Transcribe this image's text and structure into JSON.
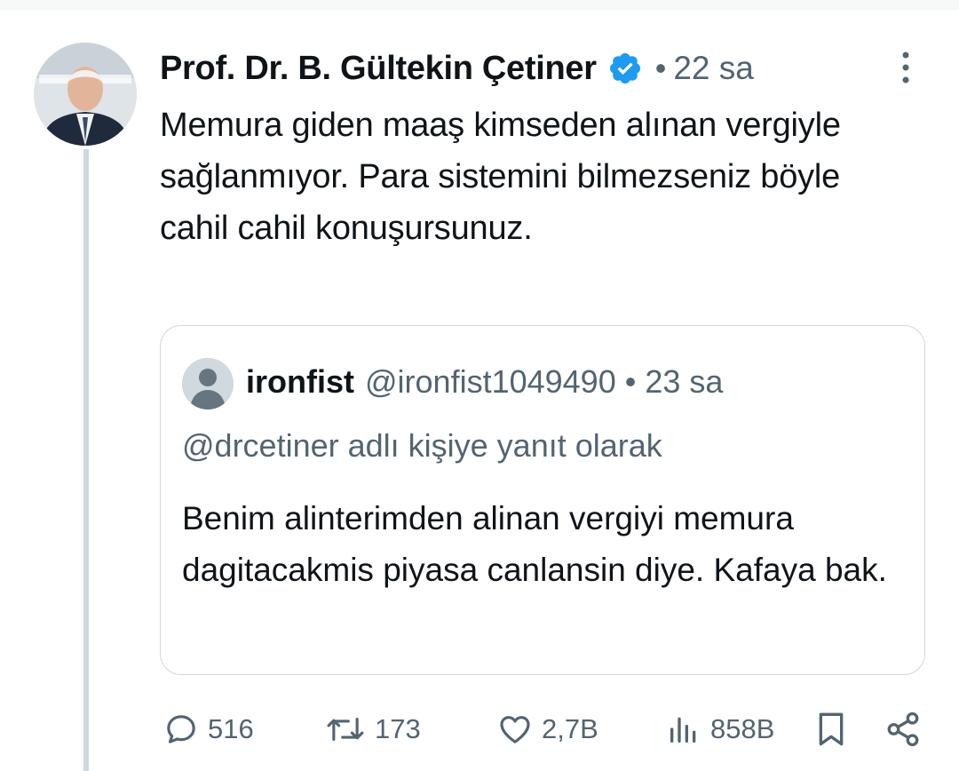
{
  "tweet": {
    "author_name": "Prof. Dr. B. Gültekin Çetiner",
    "time_separator": "•",
    "time": "22 sa",
    "text": "Memura giden maaş kimseden alınan vergiyle sağlanmıyor. Para sistemini bilmezseniz böyle cahil cahil konuşursunuz.",
    "verified_color": "#1d9bf0"
  },
  "quote": {
    "name": "ironfist",
    "handle": "@ironfist1049490",
    "time_separator": "•",
    "time": "23 sa",
    "reply_context": "@drcetiner adlı kişiye yanıt olarak",
    "text": "Benim alinterimden alinan vergiyi memura dagitacakmis piyasa canlansin diye. Kafaya bak."
  },
  "actions": {
    "reply_count": "516",
    "retweet_count": "173",
    "like_count": "2,7B",
    "views_count": "858B"
  },
  "icons": {
    "verified": "verified-badge-icon",
    "more": "more-icon",
    "reply": "reply-icon",
    "retweet": "retweet-icon",
    "like": "heart-icon",
    "views": "views-icon",
    "bookmark": "bookmark-icon",
    "share": "share-icon"
  }
}
